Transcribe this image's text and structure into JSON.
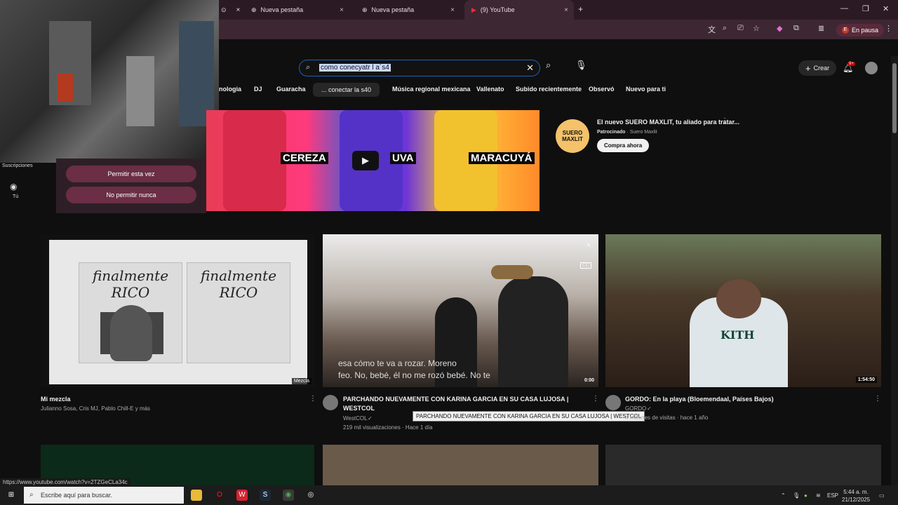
{
  "browser": {
    "tabs": [
      {
        "title": "Nueva pestaña"
      },
      {
        "title": "Nueva pestaña"
      },
      {
        "title": "(9) YouTube"
      }
    ],
    "paused_label": "En pausa",
    "profile_letter": "E",
    "status_url": "https://www.youtube.com/watch?v=2TZGeCLa34c"
  },
  "youtube": {
    "search": {
      "query": "como conecyatr l a´s4"
    },
    "header": {
      "create_label": "Crear",
      "notif_badge": "9+"
    },
    "chips": [
      "nologia",
      "DJ",
      "Guaracha",
      "... conectar la s40",
      "Música regional mexicana",
      "Vallenato",
      "Subido recientemente",
      "Observó",
      "Nuevo para ti"
    ],
    "permission": {
      "allow": "Permitir esta vez",
      "deny": "No permitir nunca"
    },
    "sidebar": {
      "subscriptions": "Suscripciones",
      "you": "Tú"
    },
    "ad": {
      "labels": [
        "CEREZA",
        "UVA",
        "MARACUYÁ"
      ],
      "logo": "SUERO MAXLIT",
      "title": "El nuevo SUERO MAXLIT, tu aliado para tratar...",
      "sponsored": "Patrocinado",
      "advertiser": "Suero Maxlit",
      "cta": "Compra ahora"
    },
    "videos": [
      {
        "title": "Mi mezcla",
        "meta": "Julianno Sosa, Cris MJ, Pablo Chill-E y más",
        "badge": "Mezcla",
        "cover_text": "finalmente RICO"
      },
      {
        "title_line1": "PARCHANDO NUEVAMENTE CON KARINA GARCIA EN SU CASA LUJOSA |",
        "title_line2": "WESTCOL",
        "channel": "WestCOL",
        "meta": "219 mil visualizaciones · Hace 1 día",
        "duration": "0:00",
        "subtitle_line1": "esa cómo te va a rozar. Moreno",
        "subtitle_line2": "feo. No, bebé, él no me rozó bebé. No te",
        "tooltip": "PARCHANDO NUEVAMENTE CON KARINA GARCIA EN SU CASA LUJOSA | WESTCOL"
      },
      {
        "title": "GORDO: En la playa (Bloemendaal, Países Bajos)",
        "channel": "GORDO",
        "meta": "4 millones de visitas · hace 1 año",
        "duration": "1:54:50",
        "shirt_text": "KITH"
      }
    ]
  },
  "taskbar": {
    "search_placeholder": "Escribe aquí para buscar.",
    "lang": "ESP",
    "time": "5:44 a. m.",
    "date": "21/12/2025"
  }
}
